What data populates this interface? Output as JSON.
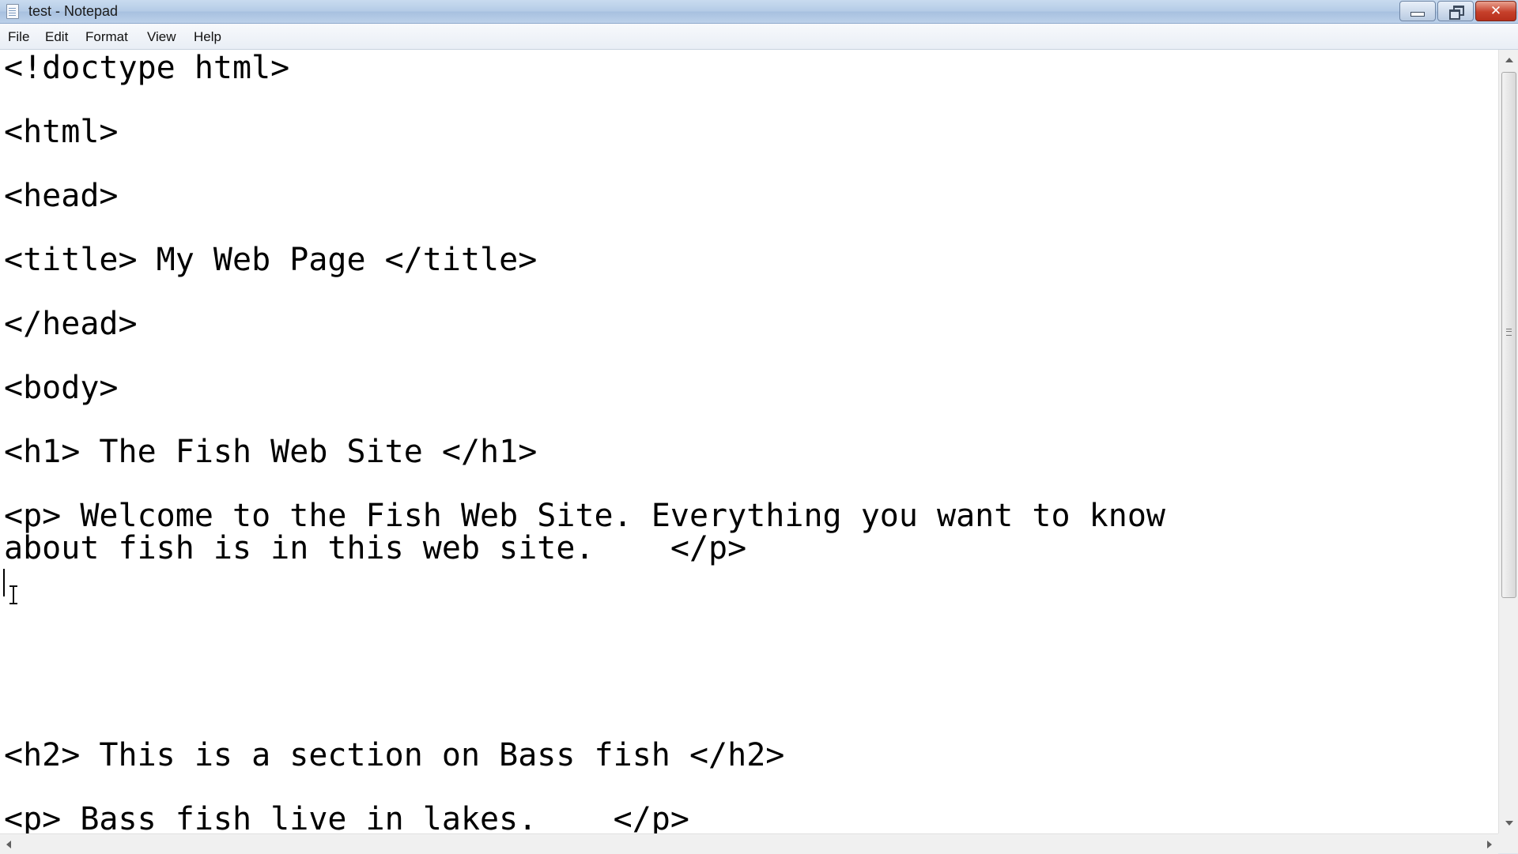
{
  "window": {
    "title": "test - Notepad",
    "icon": "notepad-icon"
  },
  "menu": {
    "items": [
      "File",
      "Edit",
      "Format",
      "View",
      "Help"
    ]
  },
  "editor": {
    "lines": [
      "<!doctype html>",
      "<html>",
      "<head>",
      "<title> My Web Page </title>",
      "</head>",
      "<body>",
      "<h1> The Fish Web Site </h1>",
      "<p> Welcome to the Fish Web Site. Everything you want to know",
      "about fish is in this web site.    </p>",
      "<h2> This is a section on Bass fish </h2>",
      "<p> Bass fish live in lakes.    </p>"
    ]
  },
  "colors": {
    "title_close": "#c6402b",
    "text": "#000000"
  }
}
